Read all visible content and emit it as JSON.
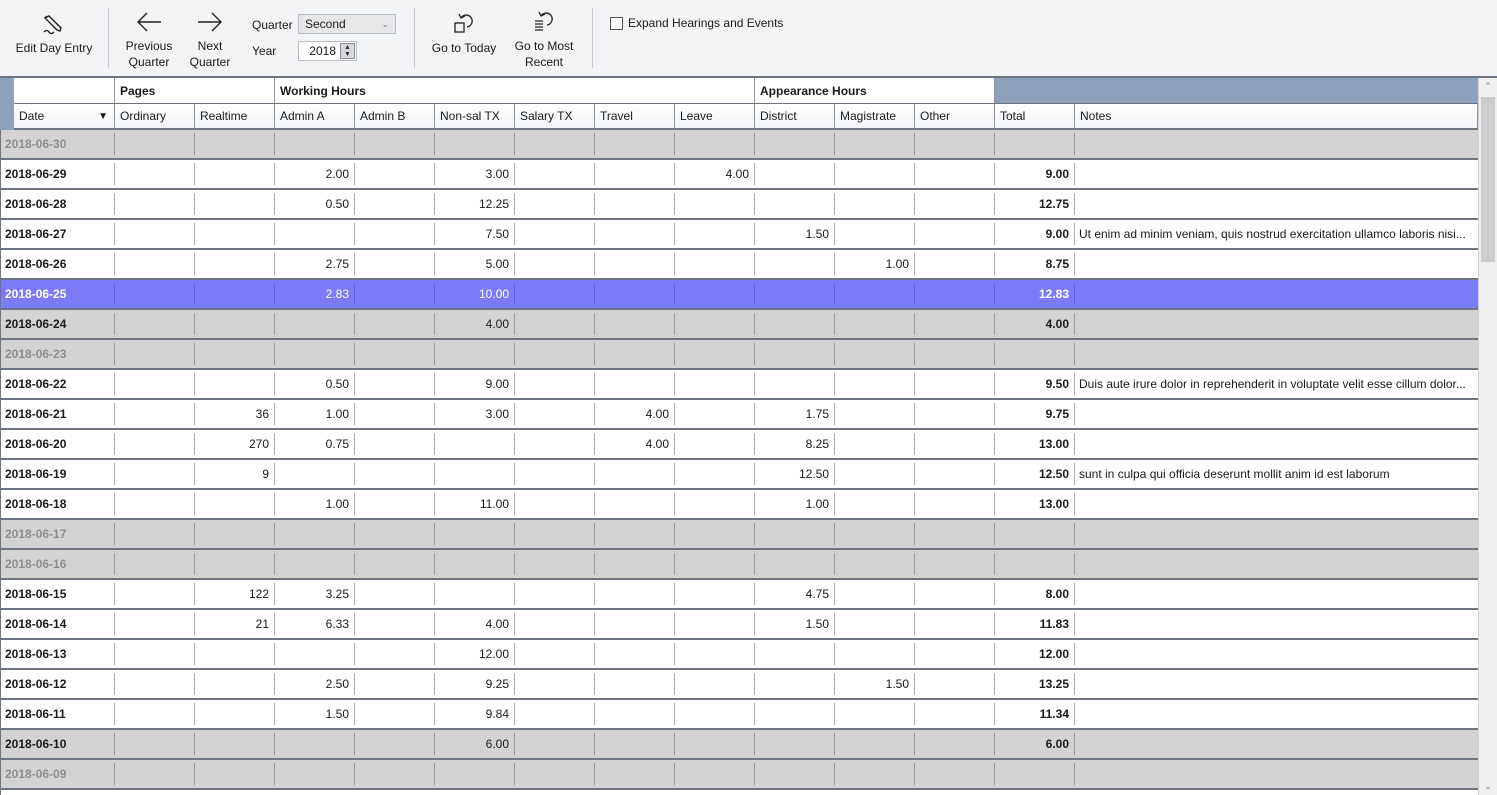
{
  "toolbar": {
    "edit_day_entry": {
      "label": "Edit Day Entry",
      "icon": "pencil-edit-icon"
    },
    "previous_quarter": {
      "label": "Previous\nQuarter",
      "icon": "arrow-left-icon"
    },
    "next_quarter": {
      "label": "Next\nQuarter",
      "icon": "arrow-right-icon"
    },
    "quarter_label": "Quarter",
    "quarter_value": "Second",
    "year_label": "Year",
    "year_value": "2018",
    "go_to_today": {
      "label": "Go to Today",
      "icon": "undo-square-icon"
    },
    "go_to_most_recent": {
      "label": "Go to Most\nRecent",
      "icon": "undo-list-icon"
    },
    "expand_checkbox": {
      "label": "Expand Hearings and Events",
      "checked": false
    }
  },
  "grid": {
    "groups": [
      {
        "label": ""
      },
      {
        "label": "Pages"
      },
      {
        "label": "Working Hours"
      },
      {
        "label": "Appearance Hours"
      }
    ],
    "columns": [
      "Date",
      "Ordinary",
      "Realtime",
      "Admin A",
      "Admin B",
      "Non-sal TX",
      "Salary TX",
      "Travel",
      "Leave",
      "District",
      "Magistrate",
      "Other",
      "Total",
      "Notes"
    ],
    "sort_column": "Date",
    "sort_direction": "descending",
    "selected_row": "2018-06-25",
    "colors": {
      "selected_row": "#7b7bf8",
      "weekend_row": "#d3d3d3",
      "header_accent": "#8da1bb"
    },
    "rows": [
      {
        "type": "weekend-empty",
        "cells": [
          "2018-06-30",
          "",
          "",
          "",
          "",
          "",
          "",
          "",
          "",
          "",
          "",
          "",
          "",
          ""
        ]
      },
      {
        "type": "normal",
        "cells": [
          "2018-06-29",
          "",
          "",
          "2.00",
          "",
          "3.00",
          "",
          "",
          "4.00",
          "",
          "",
          "",
          "9.00",
          ""
        ]
      },
      {
        "type": "normal",
        "cells": [
          "2018-06-28",
          "",
          "",
          "0.50",
          "",
          "12.25",
          "",
          "",
          "",
          "",
          "",
          "",
          "12.75",
          ""
        ]
      },
      {
        "type": "normal",
        "cells": [
          "2018-06-27",
          "",
          "",
          "",
          "",
          "7.50",
          "",
          "",
          "",
          "1.50",
          "",
          "",
          "9.00",
          "Ut enim ad minim veniam, quis nostrud exercitation ullamco laboris nisi..."
        ]
      },
      {
        "type": "normal",
        "cells": [
          "2018-06-26",
          "",
          "",
          "2.75",
          "",
          "5.00",
          "",
          "",
          "",
          "",
          "1.00",
          "",
          "8.75",
          ""
        ]
      },
      {
        "type": "selected",
        "cells": [
          "2018-06-25",
          "",
          "",
          "2.83",
          "",
          "10.00",
          "",
          "",
          "",
          "",
          "",
          "",
          "12.83",
          ""
        ]
      },
      {
        "type": "weekend",
        "cells": [
          "2018-06-24",
          "",
          "",
          "",
          "",
          "4.00",
          "",
          "",
          "",
          "",
          "",
          "",
          "4.00",
          ""
        ]
      },
      {
        "type": "weekend-empty",
        "cells": [
          "2018-06-23",
          "",
          "",
          "",
          "",
          "",
          "",
          "",
          "",
          "",
          "",
          "",
          "",
          ""
        ]
      },
      {
        "type": "normal",
        "cells": [
          "2018-06-22",
          "",
          "",
          "0.50",
          "",
          "9.00",
          "",
          "",
          "",
          "",
          "",
          "",
          "9.50",
          "Duis aute irure dolor in reprehenderit in voluptate velit esse cillum dolor..."
        ]
      },
      {
        "type": "normal",
        "cells": [
          "2018-06-21",
          "",
          "36",
          "1.00",
          "",
          "3.00",
          "",
          "4.00",
          "",
          "1.75",
          "",
          "",
          "9.75",
          ""
        ]
      },
      {
        "type": "normal",
        "cells": [
          "2018-06-20",
          "",
          "270",
          "0.75",
          "",
          "",
          "",
          "4.00",
          "",
          "8.25",
          "",
          "",
          "13.00",
          ""
        ]
      },
      {
        "type": "normal",
        "cells": [
          "2018-06-19",
          "",
          "9",
          "",
          "",
          "",
          "",
          "",
          "",
          "12.50",
          "",
          "",
          "12.50",
          "sunt in culpa qui officia deserunt mollit anim id est laborum"
        ]
      },
      {
        "type": "normal",
        "cells": [
          "2018-06-18",
          "",
          "",
          "1.00",
          "",
          "11.00",
          "",
          "",
          "",
          "1.00",
          "",
          "",
          "13.00",
          ""
        ]
      },
      {
        "type": "weekend-empty",
        "cells": [
          "2018-06-17",
          "",
          "",
          "",
          "",
          "",
          "",
          "",
          "",
          "",
          "",
          "",
          "",
          ""
        ]
      },
      {
        "type": "weekend-empty",
        "cells": [
          "2018-06-16",
          "",
          "",
          "",
          "",
          "",
          "",
          "",
          "",
          "",
          "",
          "",
          "",
          ""
        ]
      },
      {
        "type": "normal",
        "cells": [
          "2018-06-15",
          "",
          "122",
          "3.25",
          "",
          "",
          "",
          "",
          "",
          "4.75",
          "",
          "",
          "8.00",
          ""
        ]
      },
      {
        "type": "normal",
        "cells": [
          "2018-06-14",
          "",
          "21",
          "6.33",
          "",
          "4.00",
          "",
          "",
          "",
          "1.50",
          "",
          "",
          "11.83",
          ""
        ]
      },
      {
        "type": "normal",
        "cells": [
          "2018-06-13",
          "",
          "",
          "",
          "",
          "12.00",
          "",
          "",
          "",
          "",
          "",
          "",
          "12.00",
          ""
        ]
      },
      {
        "type": "normal",
        "cells": [
          "2018-06-12",
          "",
          "",
          "2.50",
          "",
          "9.25",
          "",
          "",
          "",
          "",
          "1.50",
          "",
          "13.25",
          ""
        ]
      },
      {
        "type": "normal",
        "cells": [
          "2018-06-11",
          "",
          "",
          "1.50",
          "",
          "9.84",
          "",
          "",
          "",
          "",
          "",
          "",
          "11.34",
          ""
        ]
      },
      {
        "type": "weekend",
        "cells": [
          "2018-06-10",
          "",
          "",
          "",
          "",
          "6.00",
          "",
          "",
          "",
          "",
          "",
          "",
          "6.00",
          ""
        ]
      },
      {
        "type": "weekend-empty",
        "cells": [
          "2018-06-09",
          "",
          "",
          "",
          "",
          "",
          "",
          "",
          "",
          "",
          "",
          "",
          "",
          ""
        ]
      }
    ]
  }
}
